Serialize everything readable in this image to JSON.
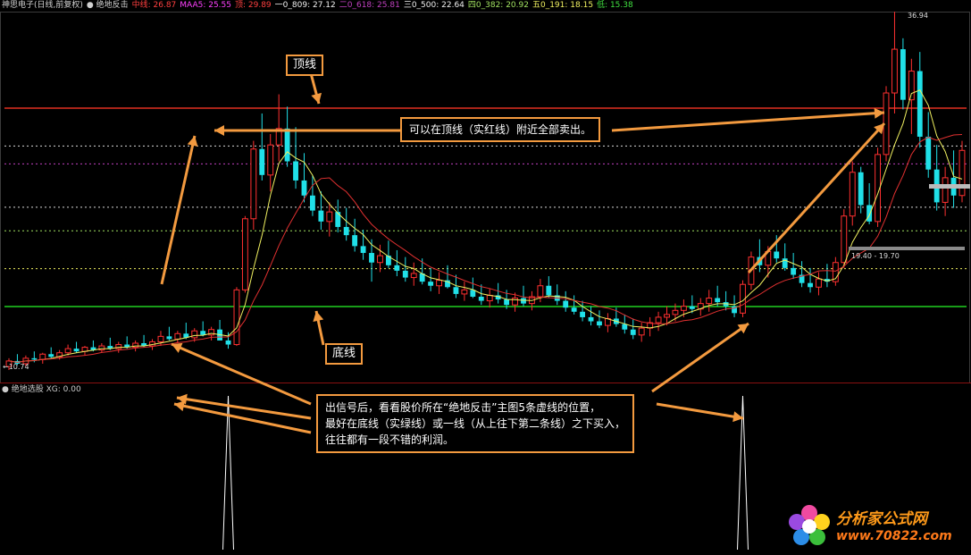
{
  "header": {
    "items": [
      {
        "text": "神思电子(日线,前复权)",
        "color": "#d0d0d0"
      },
      {
        "text": "● 绝地反击",
        "color": "#d0d0d0"
      },
      {
        "text": "中线: 26.87",
        "color": "#ff4040"
      },
      {
        "text": "MAA5: 25.55",
        "color": "#ff40ff"
      },
      {
        "text": "顶: 29.89",
        "color": "#ff4040"
      },
      {
        "text": "一0_809: 27.12",
        "color": "#f0f0f0"
      },
      {
        "text": "二0_618: 25.81",
        "color": "#c040c0"
      },
      {
        "text": "三0_500: 22.64",
        "color": "#f0f0f0"
      },
      {
        "text": "四0_382: 20.92",
        "color": "#a0e060"
      },
      {
        "text": "五0_191: 18.15",
        "color": "#f0f060"
      },
      {
        "text": "低: 15.38",
        "color": "#40e040"
      }
    ]
  },
  "subpanel": {
    "title": "● 绝地选股",
    "value": "XG: 0.00"
  },
  "annotations": {
    "top_line_label": "顶线",
    "bottom_line_label": "底线",
    "sell_note": "可以在顶线（实红线）附近全部卖出。",
    "buy_note": [
      "出信号后，看看股价所在“绝地反击”主图5条虚线的位置，",
      "最好在底线（实绿线）或一线（从上往下第二条线）之下买入，",
      "往往都有一段不错的利润。"
    ]
  },
  "price_labels": {
    "high": "36.94",
    "low": "10.74",
    "range": "19.40 - 19.70"
  },
  "logo": {
    "name": "分析家公式网",
    "url": "www.70822.com"
  },
  "chart_data": {
    "type": "candlestick",
    "title": "神思电子(日线,前复权)",
    "levels": [
      {
        "name": "顶",
        "value": 29.89,
        "style": "solid",
        "color": "#e03020"
      },
      {
        "name": "一0_809",
        "value": 27.12,
        "style": "dotted",
        "color": "#d8d8d8"
      },
      {
        "name": "二0_618",
        "value": 25.81,
        "style": "dotted",
        "color": "#c040c0"
      },
      {
        "name": "三0_500",
        "value": 22.64,
        "style": "dotted",
        "color": "#d8d8d8"
      },
      {
        "name": "四0_382",
        "value": 20.92,
        "style": "dotted",
        "color": "#a0e060"
      },
      {
        "name": "五0_191",
        "value": 18.15,
        "style": "dotted",
        "color": "#f0f060"
      },
      {
        "name": "低",
        "value": 15.38,
        "style": "solid",
        "color": "#20d020"
      }
    ],
    "candles": [
      [
        11.0,
        11.6,
        10.74,
        11.4
      ],
      [
        11.4,
        11.9,
        11.1,
        11.2
      ],
      [
        11.2,
        11.8,
        11.0,
        11.6
      ],
      [
        11.6,
        12.1,
        11.3,
        11.5
      ],
      [
        11.5,
        12.0,
        11.2,
        11.9
      ],
      [
        11.9,
        12.4,
        11.6,
        11.7
      ],
      [
        11.7,
        12.2,
        11.5,
        12.0
      ],
      [
        12.0,
        12.6,
        11.8,
        12.3
      ],
      [
        12.3,
        12.8,
        12.0,
        12.1
      ],
      [
        12.1,
        12.5,
        11.8,
        12.4
      ],
      [
        12.4,
        12.9,
        12.1,
        12.2
      ],
      [
        12.2,
        12.7,
        12.0,
        12.5
      ],
      [
        12.5,
        13.1,
        12.2,
        12.3
      ],
      [
        12.3,
        12.8,
        12.0,
        12.6
      ],
      [
        12.6,
        13.2,
        12.3,
        12.4
      ],
      [
        12.4,
        12.9,
        12.1,
        12.7
      ],
      [
        12.7,
        13.3,
        12.4,
        12.5
      ],
      [
        12.5,
        13.0,
        12.2,
        12.8
      ],
      [
        12.8,
        13.6,
        12.5,
        13.2
      ],
      [
        13.2,
        13.9,
        12.9,
        13.0
      ],
      [
        13.0,
        13.6,
        12.7,
        13.4
      ],
      [
        13.4,
        14.2,
        13.0,
        13.1
      ],
      [
        13.1,
        13.8,
        12.8,
        13.6
      ],
      [
        13.6,
        14.3,
        13.2,
        13.3
      ],
      [
        13.3,
        13.9,
        12.9,
        13.7
      ],
      [
        13.7,
        14.4,
        13.1,
        12.9
      ],
      [
        12.9,
        13.5,
        12.3,
        12.6
      ],
      [
        12.6,
        16.8,
        12.5,
        16.6
      ],
      [
        16.6,
        22.0,
        16.4,
        21.8
      ],
      [
        21.8,
        27.5,
        21.0,
        26.9
      ],
      [
        26.9,
        29.5,
        24.6,
        25.0
      ],
      [
        25.0,
        28.0,
        23.8,
        27.2
      ],
      [
        27.2,
        30.9,
        26.0,
        28.4
      ],
      [
        28.4,
        30.0,
        25.6,
        26.0
      ],
      [
        26.0,
        28.5,
        24.0,
        24.6
      ],
      [
        24.6,
        26.6,
        23.0,
        23.5
      ],
      [
        23.5,
        25.0,
        22.0,
        22.4
      ],
      [
        22.4,
        23.8,
        21.0,
        21.6
      ],
      [
        21.6,
        23.0,
        20.5,
        22.3
      ],
      [
        22.3,
        23.2,
        20.8,
        21.2
      ],
      [
        21.2,
        22.6,
        20.2,
        20.6
      ],
      [
        20.6,
        21.8,
        19.4,
        19.8
      ],
      [
        19.8,
        21.0,
        18.8,
        19.3
      ],
      [
        19.3,
        20.3,
        17.2,
        18.6
      ],
      [
        18.6,
        19.9,
        17.9,
        19.1
      ],
      [
        19.1,
        20.2,
        18.2,
        18.4
      ],
      [
        18.4,
        19.5,
        17.6,
        18.0
      ],
      [
        18.0,
        19.0,
        17.2,
        17.5
      ],
      [
        17.5,
        18.6,
        16.9,
        17.8
      ],
      [
        17.8,
        18.9,
        17.0,
        17.2
      ],
      [
        17.2,
        18.2,
        16.5,
        16.9
      ],
      [
        16.9,
        17.9,
        16.3,
        17.3
      ],
      [
        17.3,
        18.4,
        16.7,
        16.8
      ],
      [
        16.8,
        17.7,
        16.0,
        16.3
      ],
      [
        16.3,
        17.2,
        15.8,
        16.6
      ],
      [
        16.6,
        17.5,
        16.0,
        16.1
      ],
      [
        16.1,
        17.0,
        15.5,
        15.8
      ],
      [
        15.8,
        16.7,
        15.3,
        16.2
      ],
      [
        16.2,
        17.1,
        15.6,
        15.9
      ],
      [
        15.9,
        16.6,
        15.2,
        15.5
      ],
      [
        15.5,
        16.4,
        15.0,
        16.0
      ],
      [
        16.0,
        16.9,
        15.4,
        15.6
      ],
      [
        15.6,
        16.5,
        15.1,
        16.1
      ],
      [
        16.1,
        17.4,
        15.7,
        16.9
      ],
      [
        16.9,
        17.6,
        16.0,
        16.2
      ],
      [
        16.2,
        17.0,
        15.5,
        15.8
      ],
      [
        15.8,
        16.5,
        15.0,
        15.3
      ],
      [
        15.3,
        16.2,
        14.8,
        15.0
      ],
      [
        15.0,
        15.8,
        14.3,
        14.6
      ],
      [
        14.6,
        15.4,
        14.0,
        14.3
      ],
      [
        14.3,
        15.1,
        13.8,
        14.0
      ],
      [
        14.0,
        14.9,
        13.5,
        14.5
      ],
      [
        14.5,
        15.3,
        13.9,
        14.1
      ],
      [
        14.1,
        14.8,
        13.4,
        13.7
      ],
      [
        13.7,
        14.5,
        13.0,
        13.3
      ],
      [
        13.3,
        14.2,
        12.8,
        13.8
      ],
      [
        13.8,
        14.6,
        13.2,
        14.2
      ],
      [
        14.2,
        15.0,
        13.6,
        14.6
      ],
      [
        14.6,
        15.4,
        14.0,
        14.8
      ],
      [
        14.8,
        15.6,
        14.3,
        15.1
      ],
      [
        15.1,
        15.9,
        14.6,
        15.4
      ],
      [
        15.4,
        16.2,
        14.9,
        15.2
      ],
      [
        15.2,
        16.0,
        14.7,
        15.6
      ],
      [
        15.6,
        16.6,
        15.0,
        16.0
      ],
      [
        16.0,
        16.9,
        15.4,
        15.7
      ],
      [
        15.7,
        16.5,
        15.1,
        15.4
      ],
      [
        15.4,
        16.2,
        14.6,
        14.9
      ],
      [
        14.9,
        17.3,
        14.6,
        17.0
      ],
      [
        17.0,
        19.4,
        16.6,
        19.0
      ],
      [
        19.0,
        20.3,
        17.9,
        18.4
      ],
      [
        18.4,
        19.8,
        17.5,
        19.4
      ],
      [
        19.4,
        20.6,
        18.6,
        18.9
      ],
      [
        18.9,
        20.0,
        18.0,
        18.2
      ],
      [
        18.2,
        19.3,
        17.4,
        17.7
      ],
      [
        17.7,
        18.7,
        16.8,
        17.1
      ],
      [
        17.1,
        18.2,
        16.4,
        16.8
      ],
      [
        16.8,
        17.9,
        16.2,
        17.4
      ],
      [
        17.4,
        18.5,
        16.8,
        17.2
      ],
      [
        17.2,
        19.0,
        16.9,
        18.6
      ],
      [
        18.6,
        22.5,
        18.2,
        22.0
      ],
      [
        22.0,
        26.0,
        21.3,
        25.2
      ],
      [
        25.2,
        25.6,
        22.2,
        22.8
      ],
      [
        22.8,
        24.4,
        21.4,
        21.6
      ],
      [
        21.6,
        27.0,
        21.2,
        26.5
      ],
      [
        26.5,
        31.5,
        26.0,
        31.0
      ],
      [
        31.0,
        36.94,
        29.5,
        34.2
      ],
      [
        34.2,
        35.0,
        29.8,
        30.5
      ],
      [
        30.5,
        33.5,
        28.0,
        32.6
      ],
      [
        32.6,
        34.0,
        27.0,
        27.8
      ],
      [
        27.8,
        29.6,
        24.8,
        25.4
      ],
      [
        25.4,
        27.2,
        22.4,
        23.0
      ],
      [
        23.0,
        25.6,
        22.0,
        24.8
      ],
      [
        24.8,
        26.8,
        22.6,
        23.5
      ],
      [
        23.5,
        27.5,
        23.0,
        26.8
      ]
    ],
    "signals": [
      26,
      87
    ]
  }
}
